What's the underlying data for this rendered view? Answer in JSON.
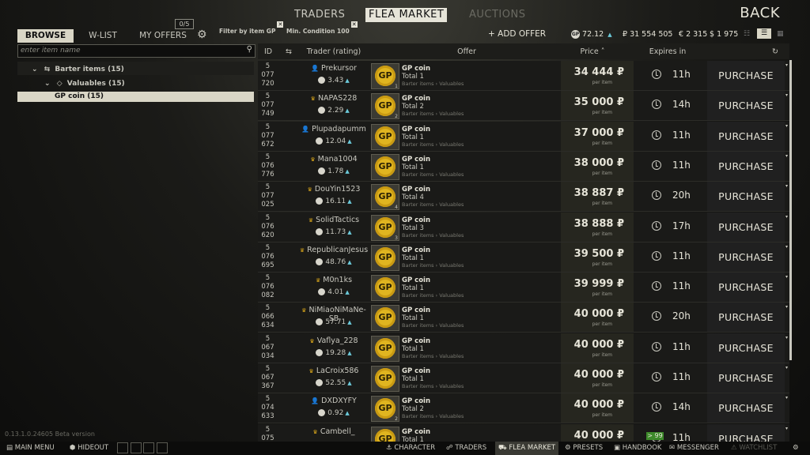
{
  "nav": {
    "traders": "TRADERS",
    "flea_market": "FLEA MARKET",
    "auctions": "AUCTIONS",
    "back": "BACK"
  },
  "left": {
    "tabs": {
      "browse": "BROWSE",
      "wlist": "W-LIST",
      "my_offers": "MY OFFERS"
    },
    "offers_badge": "0/5",
    "search_placeholder": "enter item name",
    "tree": {
      "barter": "Barter items (15)",
      "valuables": "Valuables (15)",
      "selected": "GP coin (15)"
    }
  },
  "filters": {
    "filter_item": "Filter by item GP",
    "min_condition": "Min. Condition 100"
  },
  "toolbar": {
    "add_offer": "+ ADD OFFER",
    "gp_balance": "72.12",
    "roubles": "₽ 31 554 505",
    "euros": "€ 2 315",
    "dollars": "$ 1 975"
  },
  "columns": {
    "id": "ID",
    "trader": "Trader (rating)",
    "offer": "Offer",
    "price": "Price",
    "expires": "Expires in"
  },
  "rows": [
    {
      "id": "5\n077\n720",
      "trader": "Prekursor",
      "icon": "person",
      "rating": "3.43",
      "qty": "1",
      "total": "Total 1",
      "price": "34 444 ₽",
      "expires": "11h"
    },
    {
      "id": "5\n077\n749",
      "trader": "NAPAS228",
      "icon": "crown",
      "rating": "2.29",
      "qty": "2",
      "total": "Total 2",
      "price": "35 000 ₽",
      "expires": "14h"
    },
    {
      "id": "5\n077\n672",
      "trader": "Plupadapumm",
      "icon": "person",
      "rating": "12.04",
      "qty": "",
      "total": "Total 1",
      "price": "37 000 ₽",
      "expires": "11h"
    },
    {
      "id": "5\n076\n776",
      "trader": "Mana1004",
      "icon": "crown",
      "rating": "1.78",
      "qty": "",
      "total": "Total 1",
      "price": "38 000 ₽",
      "expires": "11h"
    },
    {
      "id": "5\n077\n025",
      "trader": "DouYin1523",
      "icon": "crown",
      "rating": "16.11",
      "qty": "4",
      "total": "Total 4",
      "price": "38 887 ₽",
      "expires": "20h"
    },
    {
      "id": "5\n076\n620",
      "trader": "SolidTactics",
      "icon": "crown",
      "rating": "11.73",
      "qty": "3",
      "total": "Total 3",
      "price": "38 888 ₽",
      "expires": "17h"
    },
    {
      "id": "5\n076\n695",
      "trader": "RepublicanJesus",
      "icon": "crown",
      "rating": "48.76",
      "qty": "",
      "total": "Total 1",
      "price": "39 500 ₽",
      "expires": "11h"
    },
    {
      "id": "5\n076\n082",
      "trader": "M0n1ks",
      "icon": "crown",
      "rating": "4.01",
      "qty": "",
      "total": "Total 1",
      "price": "39 999 ₽",
      "expires": "11h"
    },
    {
      "id": "5\n066\n634",
      "trader": "NiMiaoNiMaNe-SB",
      "icon": "crown",
      "rating": "57.71",
      "qty": "",
      "total": "Total 1",
      "price": "40 000 ₽",
      "expires": "20h"
    },
    {
      "id": "5\n067\n034",
      "trader": "Vaflya_228",
      "icon": "crown",
      "rating": "19.28",
      "qty": "",
      "total": "Total 1",
      "price": "40 000 ₽",
      "expires": "11h"
    },
    {
      "id": "5\n067\n367",
      "trader": "LaCroix586",
      "icon": "crown",
      "rating": "52.55",
      "qty": "",
      "total": "Total 1",
      "price": "40 000 ₽",
      "expires": "11h"
    },
    {
      "id": "5\n074\n633",
      "trader": "DXDXYFY",
      "icon": "person",
      "rating": "0.92",
      "qty": "2",
      "total": "Total 2",
      "price": "40 000 ₽",
      "expires": "14h"
    },
    {
      "id": "5\n075",
      "trader": "Cambell_",
      "icon": "crown",
      "rating": "",
      "qty": "",
      "total": "Total 1",
      "price": "40 000 ₽",
      "expires": "11h"
    }
  ],
  "offer_common": {
    "item_name": "GP coin",
    "coin_text": "GP",
    "category": "Barter items › Valuables",
    "per_item": "per item",
    "purchase": "PURCHASE"
  },
  "green_badge": "> 99",
  "version": "0.13.1.0.24605 Beta version",
  "bottom": {
    "main_menu": "MAIN MENU",
    "hideout": "HIDEOUT",
    "character": "CHARACTER",
    "traders": "TRADERS",
    "flea_market": "FLEA MARKET",
    "presets": "PRESETS",
    "handbook": "HANDBOOK",
    "messenger": "MESSENGER",
    "watchlist": "WATCHLIST"
  },
  "colors": {
    "accent": "#e0b520",
    "highlight": "#d9d6c6",
    "rating_up": "#6bc9d9",
    "crown": "#d3a21b"
  }
}
